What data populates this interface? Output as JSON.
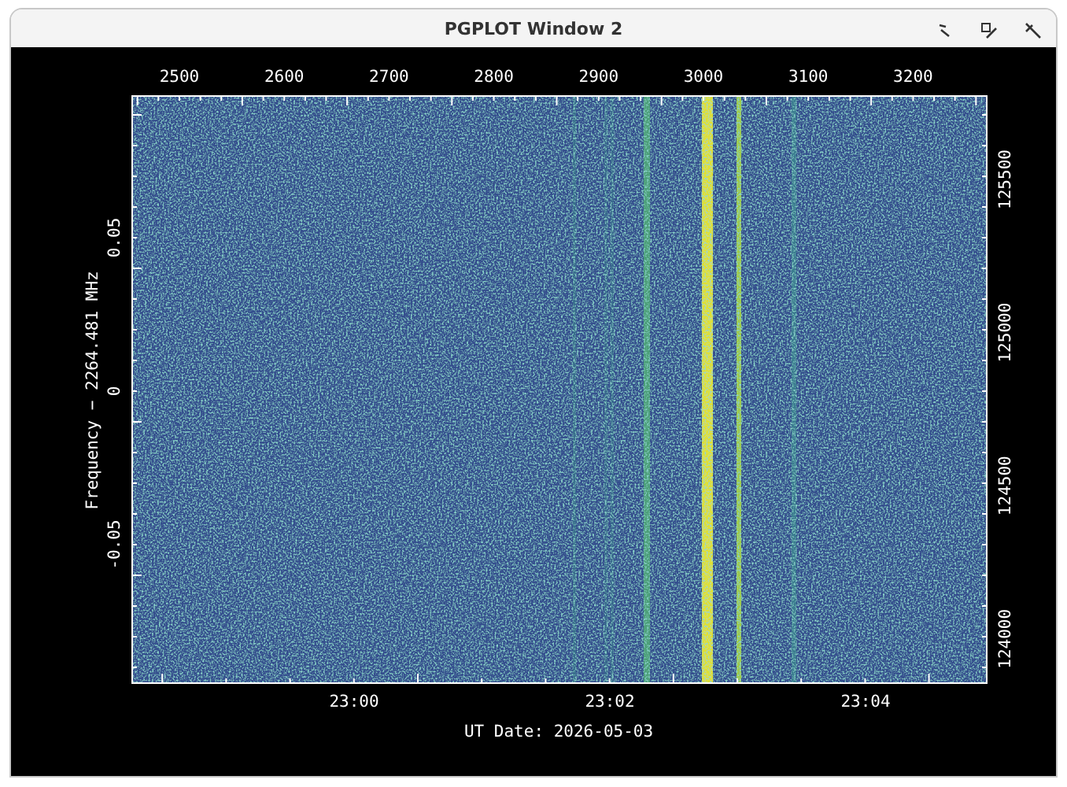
{
  "window": {
    "title": "PGPLOT Window 2"
  },
  "plot": {
    "top_ticks": [
      "2500",
      "2600",
      "2700",
      "2800",
      "2900",
      "3000",
      "3100",
      "3200"
    ],
    "bottom_ticks": [
      "23:00",
      "23:02",
      "23:04"
    ],
    "bottom_label": "UT Date: 2026-05-03",
    "left_ticks": [
      "0.05",
      "0",
      "-0.05"
    ],
    "left_label": "Frequency − 2264.481 MHz",
    "right_ticks": [
      "125500",
      "125000",
      "124500",
      "124000"
    ]
  }
}
